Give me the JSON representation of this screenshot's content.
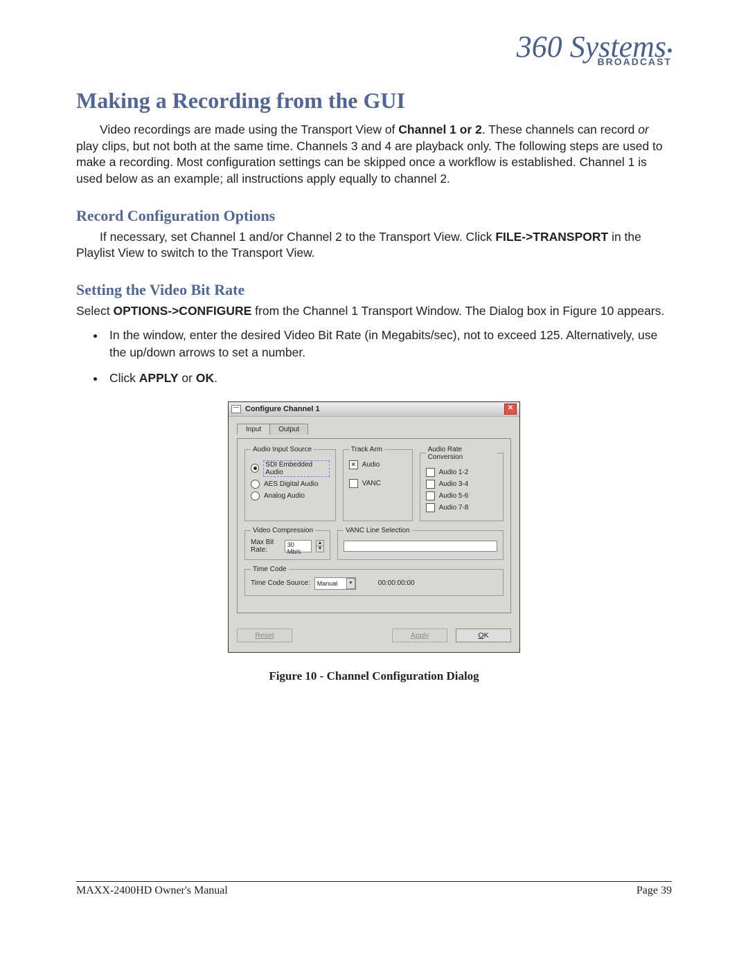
{
  "logo": {
    "script": "360 Systems",
    "sub": "BROADCAST"
  },
  "h1": "Making a Recording from the GUI",
  "para1_a": "Video recordings are made using the Transport View of ",
  "para1_bold": "Channel 1 or 2",
  "para1_b": ". These channels can record ",
  "para1_ital": "or",
  "para1_c": " play clips, but not both at the same time. Channels 3 and 4 are playback only. The following steps are used to make a recording. Most configuration settings can be skipped once a workflow is established. Channel 1 is used below as an example; all instructions apply equally to channel 2.",
  "h2a": "Record Configuration Options",
  "para2_a": "If necessary, set Channel 1 and/or Channel 2 to the Transport View. Click ",
  "para2_bold": "FILE->TRANSPORT",
  "para2_b": " in the Playlist View to switch to the Transport View.",
  "h2b": "Setting the Video Bit Rate",
  "para3_a": "Select ",
  "para3_bold": "OPTIONS->CONFIGURE",
  "para3_b": " from the Channel 1 Transport Window. The Dialog box in Figure 10 appears.",
  "bul1": "In the window, enter the desired Video Bit Rate (in Megabits/sec), not to exceed 125. Alternatively, use the up/down arrows to set a number.",
  "bul2_a": "Click ",
  "bul2_bold1": "APPLY",
  "bul2_mid": " or ",
  "bul2_bold2": "OK",
  "bul2_end": ".",
  "dialog": {
    "title": "Configure Channel 1",
    "tabs": {
      "input": "Input",
      "output": "Output"
    },
    "audio_src": {
      "legend": "Audio Input Source",
      "sdi": "SDI Embedded Audio",
      "aes": "AES Digital Audio",
      "analog": "Analog Audio"
    },
    "track_arm": {
      "legend": "Track Arm",
      "audio": "Audio",
      "vanc": "VANC"
    },
    "arc": {
      "legend": "Audio Rate Conversion",
      "a12": "Audio 1-2",
      "a34": "Audio 3-4",
      "a56": "Audio 5-6",
      "a78": "Audio 7-8"
    },
    "vcomp": {
      "legend": "Video Compression",
      "label": "Max Bit Rate:",
      "value": "30 Mb/s"
    },
    "vanc_sel": {
      "legend": "VANC Line Selection"
    },
    "tc": {
      "legend": "Time Code",
      "label": "Time Code Source:",
      "value": "Manual",
      "display": "00:00:00:00"
    },
    "buttons": {
      "reset": "Reset",
      "apply": "Apply",
      "ok_pre": "O",
      "ok_rest": "K"
    }
  },
  "caption": "Figure 10 - Channel Configuration Dialog",
  "footer": {
    "left": "MAXX-2400HD Owner's Manual",
    "right": "Page 39"
  }
}
